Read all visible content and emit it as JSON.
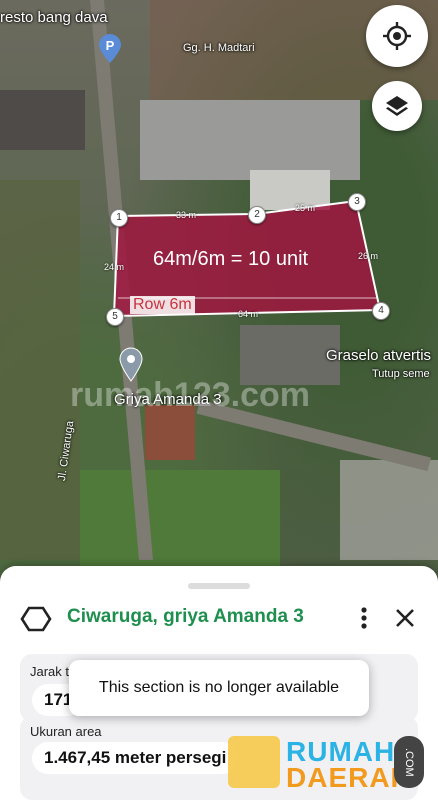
{
  "map": {
    "labels": {
      "restaurant": "resto bang dava",
      "street_top": "Gg. H. Madtari",
      "poi_right": "Graselo atvertis",
      "poi_right_sub": "Tutup seme",
      "place_pin": "Griya Amanda 3",
      "road_vertical": "Jl. Ciwaruga"
    },
    "plot": {
      "label": "64m/6m = 10 unit",
      "row_label": "Row 6m",
      "dimensions": {
        "top_left": "33 m",
        "top_right": "25 m",
        "right": "26 m",
        "left": "24 m",
        "bottom": "64 m"
      },
      "vertices": [
        "1",
        "2",
        "3",
        "4",
        "5"
      ]
    },
    "watermark": "rumah123.com",
    "parking_letter": "P",
    "colors": {
      "plot_fill": "#a0163f",
      "plot_stroke": "#ffffff"
    }
  },
  "controls": {
    "locate_icon": "crosshair-icon",
    "layers_icon": "layers-icon"
  },
  "sheet": {
    "title": "Ciwaruga, griya Amanda 3",
    "title_color": "#1e8f4e",
    "title_icon": "polygon-icon",
    "more_icon": "more-vertical-icon",
    "close_icon": "close-icon",
    "fields": [
      {
        "label": "Jarak to",
        "value": "171"
      },
      {
        "label": "Ukuran area",
        "value": "1.467,45 meter persegi"
      }
    ]
  },
  "toast": {
    "message": "This section is no longer available"
  },
  "logo": {
    "line1": "RUMAH",
    "line2": "DAERAH",
    "suffix": ".COM"
  }
}
